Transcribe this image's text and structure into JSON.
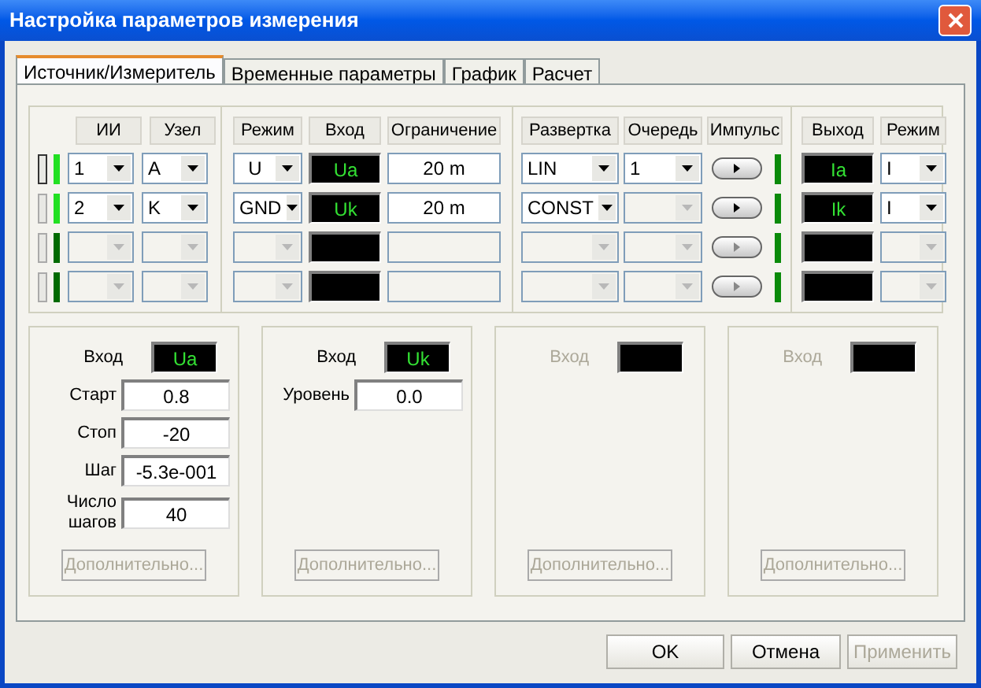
{
  "window": {
    "title": "Настройка параметров измерения"
  },
  "tabs": [
    {
      "label": "Источник/Измеритель",
      "selected": true
    },
    {
      "label": "Временные параметры",
      "selected": false
    },
    {
      "label": "График",
      "selected": false
    },
    {
      "label": "Расчет",
      "selected": false
    }
  ],
  "table": {
    "column_groups": [
      [
        "ИИ",
        "Узел"
      ],
      [
        "Режим",
        "Вход",
        "Ограничение"
      ],
      [
        "Развертка",
        "Очередь",
        "Импульс"
      ],
      [
        "Выход",
        "Режим"
      ]
    ],
    "rows": [
      {
        "selected": true,
        "active": true,
        "source": {
          "value": "1",
          "disabled": false
        },
        "node": {
          "value": "A",
          "disabled": false
        },
        "mode": {
          "value": "U",
          "disabled": false
        },
        "input": "Ua",
        "limit": {
          "value": "20 m",
          "disabled": false
        },
        "sweep": {
          "value": "LIN",
          "disabled": false
        },
        "queue": {
          "value": "1",
          "disabled": false
        },
        "pulse_disabled": false,
        "output": "Ia",
        "output_mode": {
          "value": "I",
          "disabled": false
        }
      },
      {
        "selected": false,
        "active": true,
        "source": {
          "value": "2",
          "disabled": false
        },
        "node": {
          "value": "K",
          "disabled": false
        },
        "mode": {
          "value": "GND",
          "disabled": false
        },
        "input": "Uk",
        "limit": {
          "value": "20 m",
          "disabled": false
        },
        "sweep": {
          "value": "CONST",
          "disabled": false
        },
        "queue": {
          "disabled": true
        },
        "pulse_disabled": false,
        "output": "Ik",
        "output_mode": {
          "value": "I",
          "disabled": false
        }
      },
      {
        "selected": false,
        "active": false,
        "source": {
          "disabled": true
        },
        "node": {
          "disabled": true
        },
        "mode": {
          "disabled": true
        },
        "limit": {
          "disabled": true
        },
        "sweep": {
          "disabled": true
        },
        "queue": {
          "disabled": true
        },
        "pulse_disabled": true,
        "output_mode": {
          "disabled": true
        }
      },
      {
        "selected": false,
        "active": false,
        "source": {
          "disabled": true
        },
        "node": {
          "disabled": true
        },
        "mode": {
          "disabled": true
        },
        "limit": {
          "disabled": true
        },
        "sweep": {
          "disabled": true
        },
        "queue": {
          "disabled": true
        },
        "pulse_disabled": true,
        "output_mode": {
          "disabled": true
        }
      }
    ]
  },
  "panels": [
    {
      "disabled": false,
      "input_label": "Вход",
      "input": "Ua",
      "fields": [
        {
          "label": "Старт",
          "value": "0.8"
        },
        {
          "label": "Стоп",
          "value": "-20"
        },
        {
          "label": "Шаг",
          "value": "-5.3e-001"
        },
        {
          "label": "Число шагов",
          "value": "40"
        }
      ],
      "more_button": {
        "label": "Дополнительно...",
        "disabled": true
      }
    },
    {
      "disabled": false,
      "input_label": "Вход",
      "input": "Uk",
      "fields": [
        {
          "label": "Уровень",
          "value": "0.0"
        }
      ],
      "more_button": {
        "label": "Дополнительно...",
        "disabled": true
      }
    },
    {
      "disabled": true,
      "input_label": "Вход",
      "more_button": {
        "label": "Дополнительно...",
        "disabled": true
      }
    },
    {
      "disabled": true,
      "input_label": "Вход",
      "more_button": {
        "label": "Дополнительно...",
        "disabled": true
      }
    }
  ],
  "buttons": [
    {
      "label": "OK",
      "disabled": false
    },
    {
      "label": "Отмена",
      "disabled": false
    },
    {
      "label": "Применить",
      "disabled": true
    }
  ]
}
